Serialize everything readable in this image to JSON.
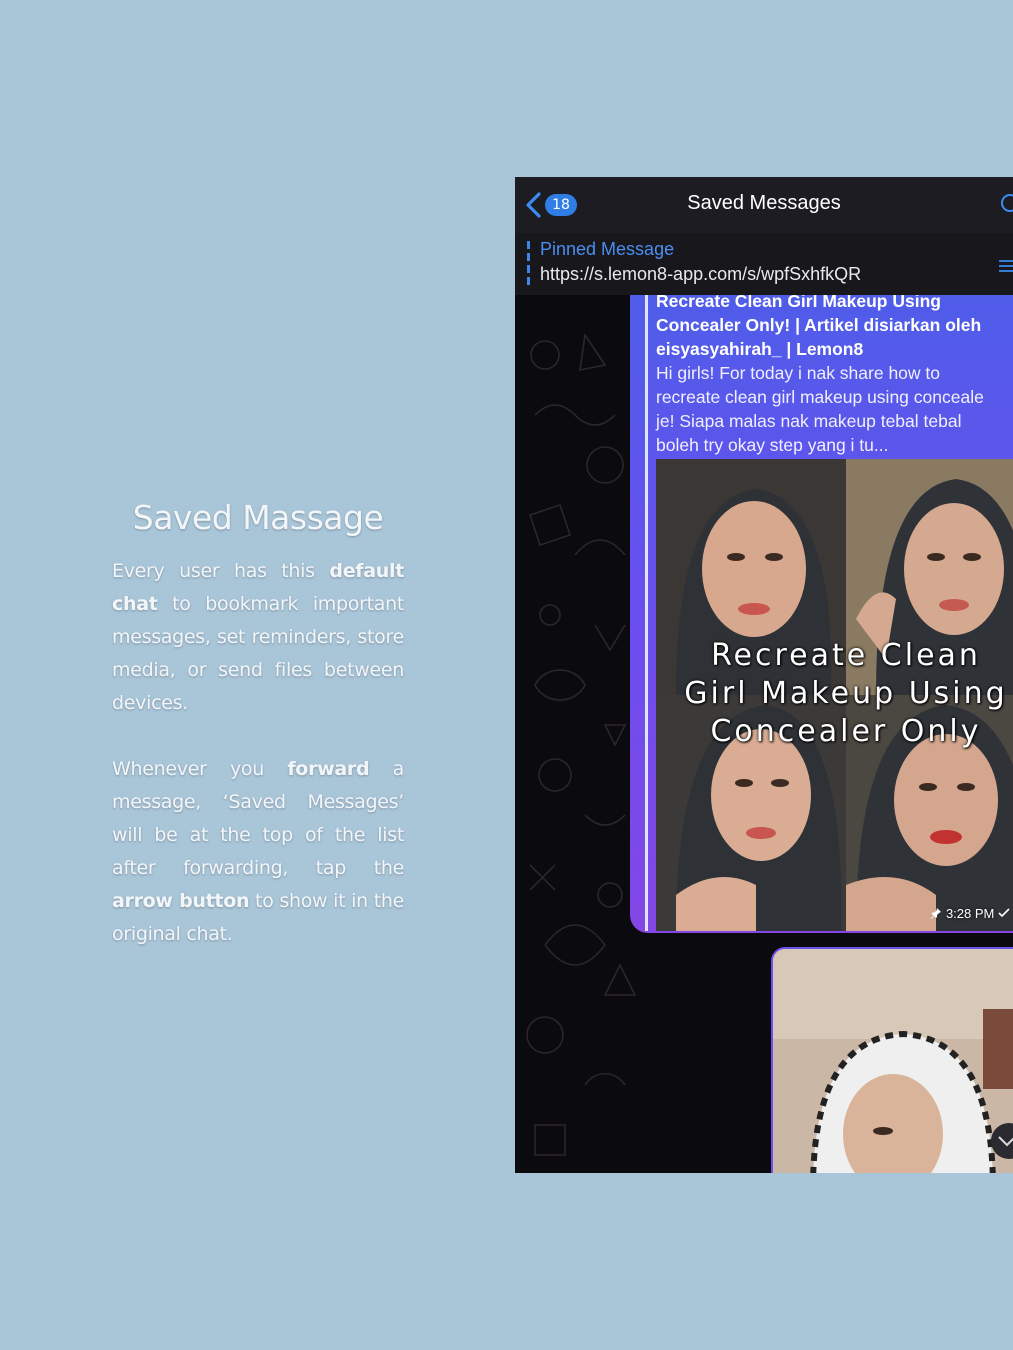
{
  "explainer": {
    "heading": "Saved Massage",
    "para1": [
      {
        "t": "Every user has this ",
        "b": false
      },
      {
        "t": "default chat",
        "b": true
      },
      {
        "t": " to bookmark important messages, set reminders, store media, or send files between devices.",
        "b": false
      }
    ],
    "para2": [
      {
        "t": "Whenever you ",
        "b": false
      },
      {
        "t": "forward",
        "b": true
      },
      {
        "t": " a message, ‘Saved Messages’ will be at the top of the list after forwarding, tap the ",
        "b": false
      },
      {
        "t": "arrow button",
        "b": true
      },
      {
        "t": " to show it in the original chat.",
        "b": false
      }
    ]
  },
  "phone": {
    "nav": {
      "unread_count": "18",
      "title": "Saved Messages"
    },
    "pinned": {
      "label": "Pinned Message",
      "url": "https://s.lemon8-app.com/s/wpfSxhfkQR"
    },
    "message": {
      "link_title_lines": [
        "Recreate Clean Girl Makeup Using",
        "Concealer Only!  | Artikel disiarkan oleh",
        "eisyasyahirah_ | Lemon8"
      ],
      "link_desc_lines": [
        "Hi girls! For today i nak share how to",
        "recreate clean girl makeup using conceale",
        "je! Siapa malas nak makeup tebal tebal",
        "boleh try okay step yang i tu..."
      ],
      "overlay_lines": [
        "Recreate Clean",
        "Girl Makeup Using",
        "Concealer Only"
      ],
      "time": "3:28 PM"
    },
    "colors": {
      "accent": "#2f7ee6",
      "bubble_top": "#4f5de9",
      "bubble_bottom": "#8447e6"
    }
  }
}
